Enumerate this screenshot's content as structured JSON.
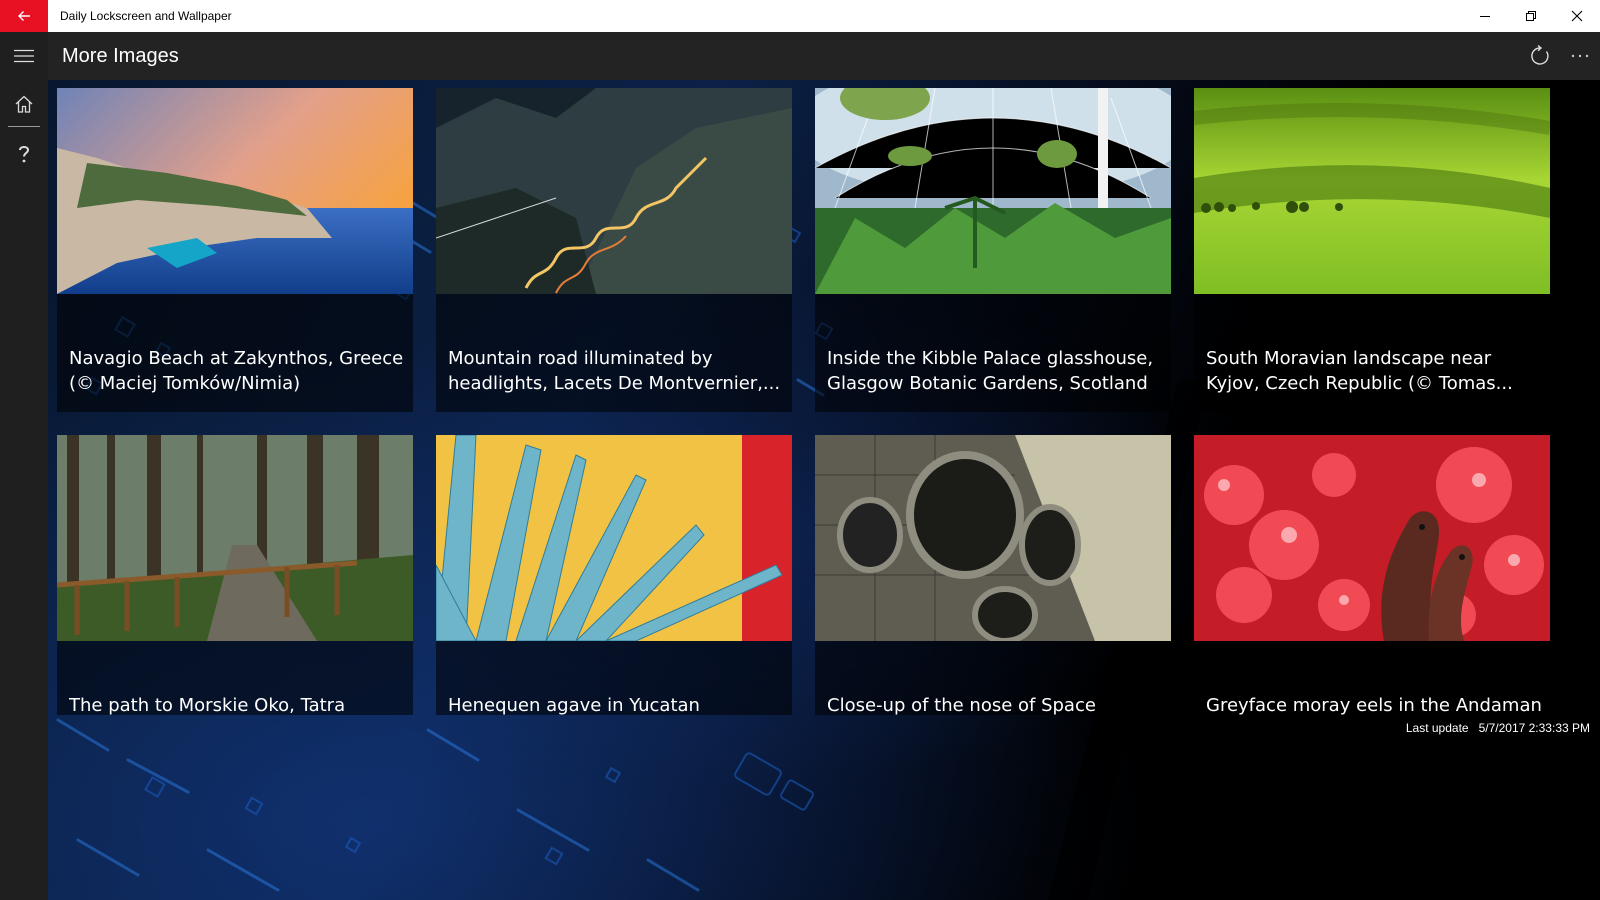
{
  "window": {
    "title": "Daily Lockscreen and Wallpaper"
  },
  "header": {
    "title": "More Images",
    "refresh_icon": "refresh-icon",
    "more_icon": "more-icon"
  },
  "nav": {
    "items": [
      {
        "name": "menu",
        "icon": "hamburger-icon"
      },
      {
        "name": "home",
        "icon": "home-icon"
      },
      {
        "name": "help",
        "icon": "question-icon"
      }
    ]
  },
  "images": [
    {
      "caption": "Navagio Beach at Zakynthos, Greece (© Maciej Tomków/Nimia)"
    },
    {
      "caption": "Mountain road illuminated by headlights, Lacets De Montvernier,..."
    },
    {
      "caption": "Inside the Kibble Palace glasshouse, Glasgow Botanic Gardens, Scotland (©..."
    },
    {
      "caption": "South Moravian landscape near Kyjov, Czech Republic (© Tomas..."
    },
    {
      "caption": "The path to Morskie Oko, Tatra National"
    },
    {
      "caption": "Henequen agave in Yucatan Peninsula,"
    },
    {
      "caption": "Close-up of the nose of Space Shuttle"
    },
    {
      "caption": "Greyface moray eels in the Andaman"
    }
  ],
  "status": {
    "last_update_label": "Last update",
    "last_update_value": "5/7/2017 2:33:33 PM"
  },
  "colors": {
    "accent": "#e81123",
    "rail": "#1f1f1f",
    "header": "#232323"
  }
}
